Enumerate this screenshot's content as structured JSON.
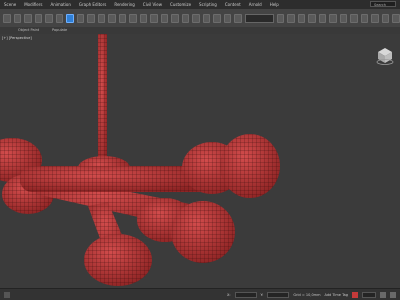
{
  "menubar": {
    "items": [
      "Scene",
      "Modifiers",
      "Animation",
      "Graph Editors",
      "Rendering",
      "Civil View",
      "Customize",
      "Scripting",
      "Content",
      "Arnold",
      "Help"
    ],
    "search_placeholder": "Search"
  },
  "toolbar": {
    "dropdown_label": "Create Selection Set"
  },
  "ribbon": {
    "tabs": [
      "Object Paint",
      "Populate"
    ]
  },
  "viewport": {
    "label": "[+] [Perspective]",
    "model_color": "#b83a3a",
    "wire_color": "#3a0c0c",
    "background": "#3b3b3b"
  },
  "statusbar": {
    "x_label": "X:",
    "y_label": "Y:",
    "grid_text": "Grid = 10,0mm",
    "add_time_tag": "Add Time Tag",
    "key_color": "#c43a3a"
  }
}
